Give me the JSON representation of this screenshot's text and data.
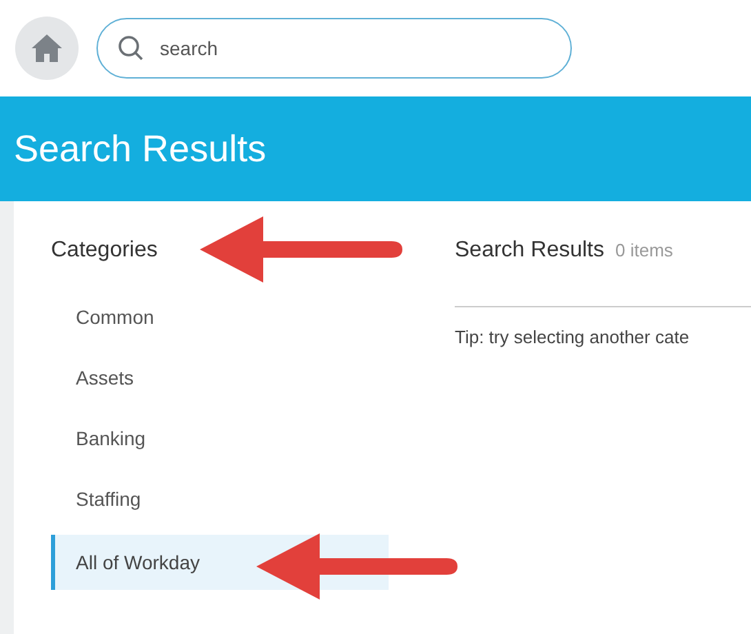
{
  "search": {
    "placeholder": "search"
  },
  "header": {
    "title": "Search Results"
  },
  "categories": {
    "title": "Categories",
    "items": [
      {
        "label": "Common",
        "selected": false
      },
      {
        "label": "Assets",
        "selected": false
      },
      {
        "label": "Banking",
        "selected": false
      },
      {
        "label": "Staffing",
        "selected": false
      },
      {
        "label": "All of Workday",
        "selected": true
      }
    ]
  },
  "results": {
    "title": "Search Results",
    "count": "0 items",
    "tip": "Tip: try selecting another cate"
  }
}
